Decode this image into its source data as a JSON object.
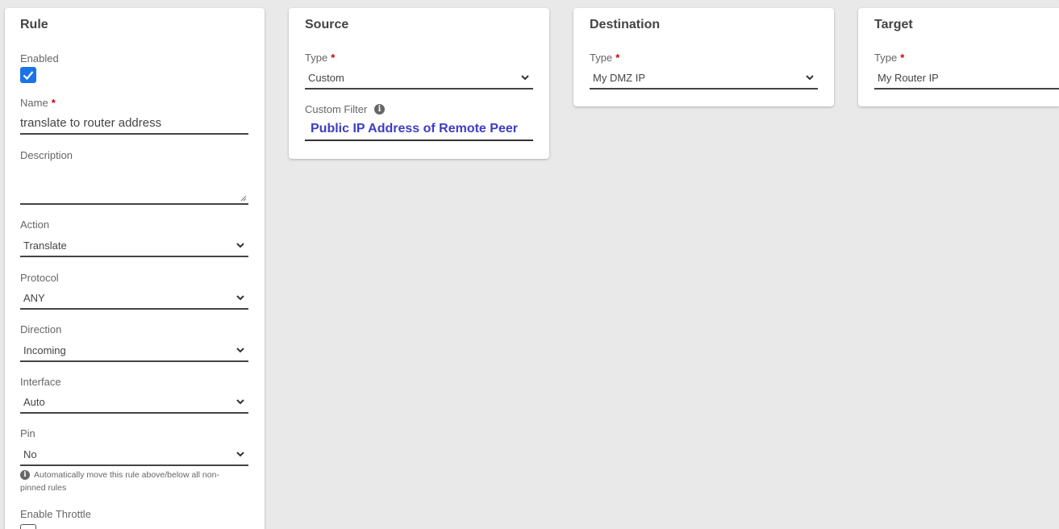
{
  "rule": {
    "title": "Rule",
    "enabled_label": "Enabled",
    "enabled_checked": true,
    "name_label": "Name",
    "name_value": "translate to router address",
    "description_label": "Description",
    "description_value": "",
    "action_label": "Action",
    "action_value": "Translate",
    "protocol_label": "Protocol",
    "protocol_value": "ANY",
    "direction_label": "Direction",
    "direction_value": "Incoming",
    "interface_label": "Interface",
    "interface_value": "Auto",
    "pin_label": "Pin",
    "pin_value": "No",
    "pin_hint": "Automatically move this rule above/below all non-pinned rules",
    "throttle_label": "Enable Throttle",
    "required_mark": "*"
  },
  "source": {
    "title": "Source",
    "type_label": "Type",
    "type_value": "Custom",
    "custom_filter_label": "Custom Filter",
    "custom_filter_value": "Public IP Address of Remote Peer"
  },
  "destination": {
    "title": "Destination",
    "type_label": "Type",
    "type_value": "My DMZ IP"
  },
  "target": {
    "title": "Target",
    "type_label": "Type",
    "type_value": "My Router IP"
  },
  "colors": {
    "background": "#e9e9e9",
    "card": "#ffffff",
    "checkbox_accent": "#1a73e8",
    "required": "#cc0000",
    "custom_filter_text": "#3d3dc4"
  },
  "icons": {
    "info": "info-circle-icon",
    "chevron": "chevron-down-icon",
    "check": "checkmark-icon"
  }
}
